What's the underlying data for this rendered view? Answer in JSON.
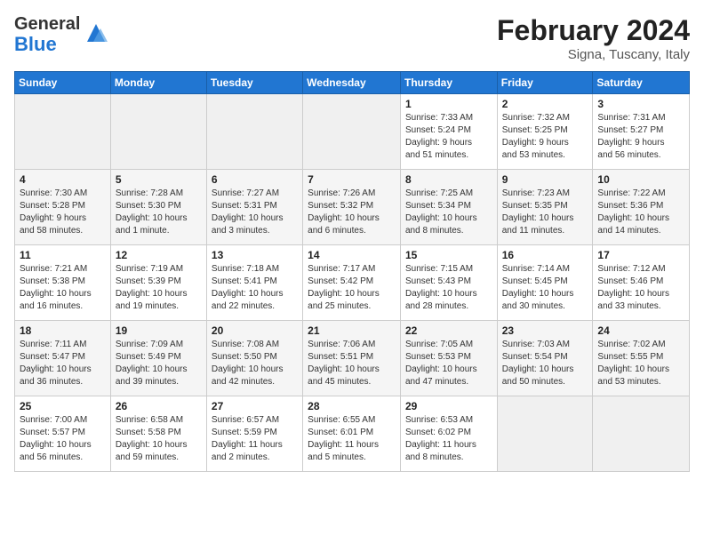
{
  "logo": {
    "line1": "General",
    "line2": "Blue"
  },
  "header": {
    "title": "February 2024",
    "subtitle": "Signa, Tuscany, Italy"
  },
  "weekdays": [
    "Sunday",
    "Monday",
    "Tuesday",
    "Wednesday",
    "Thursday",
    "Friday",
    "Saturday"
  ],
  "weeks": [
    [
      {
        "day": "",
        "info": ""
      },
      {
        "day": "",
        "info": ""
      },
      {
        "day": "",
        "info": ""
      },
      {
        "day": "",
        "info": ""
      },
      {
        "day": "1",
        "info": "Sunrise: 7:33 AM\nSunset: 5:24 PM\nDaylight: 9 hours\nand 51 minutes."
      },
      {
        "day": "2",
        "info": "Sunrise: 7:32 AM\nSunset: 5:25 PM\nDaylight: 9 hours\nand 53 minutes."
      },
      {
        "day": "3",
        "info": "Sunrise: 7:31 AM\nSunset: 5:27 PM\nDaylight: 9 hours\nand 56 minutes."
      }
    ],
    [
      {
        "day": "4",
        "info": "Sunrise: 7:30 AM\nSunset: 5:28 PM\nDaylight: 9 hours\nand 58 minutes."
      },
      {
        "day": "5",
        "info": "Sunrise: 7:28 AM\nSunset: 5:30 PM\nDaylight: 10 hours\nand 1 minute."
      },
      {
        "day": "6",
        "info": "Sunrise: 7:27 AM\nSunset: 5:31 PM\nDaylight: 10 hours\nand 3 minutes."
      },
      {
        "day": "7",
        "info": "Sunrise: 7:26 AM\nSunset: 5:32 PM\nDaylight: 10 hours\nand 6 minutes."
      },
      {
        "day": "8",
        "info": "Sunrise: 7:25 AM\nSunset: 5:34 PM\nDaylight: 10 hours\nand 8 minutes."
      },
      {
        "day": "9",
        "info": "Sunrise: 7:23 AM\nSunset: 5:35 PM\nDaylight: 10 hours\nand 11 minutes."
      },
      {
        "day": "10",
        "info": "Sunrise: 7:22 AM\nSunset: 5:36 PM\nDaylight: 10 hours\nand 14 minutes."
      }
    ],
    [
      {
        "day": "11",
        "info": "Sunrise: 7:21 AM\nSunset: 5:38 PM\nDaylight: 10 hours\nand 16 minutes."
      },
      {
        "day": "12",
        "info": "Sunrise: 7:19 AM\nSunset: 5:39 PM\nDaylight: 10 hours\nand 19 minutes."
      },
      {
        "day": "13",
        "info": "Sunrise: 7:18 AM\nSunset: 5:41 PM\nDaylight: 10 hours\nand 22 minutes."
      },
      {
        "day": "14",
        "info": "Sunrise: 7:17 AM\nSunset: 5:42 PM\nDaylight: 10 hours\nand 25 minutes."
      },
      {
        "day": "15",
        "info": "Sunrise: 7:15 AM\nSunset: 5:43 PM\nDaylight: 10 hours\nand 28 minutes."
      },
      {
        "day": "16",
        "info": "Sunrise: 7:14 AM\nSunset: 5:45 PM\nDaylight: 10 hours\nand 30 minutes."
      },
      {
        "day": "17",
        "info": "Sunrise: 7:12 AM\nSunset: 5:46 PM\nDaylight: 10 hours\nand 33 minutes."
      }
    ],
    [
      {
        "day": "18",
        "info": "Sunrise: 7:11 AM\nSunset: 5:47 PM\nDaylight: 10 hours\nand 36 minutes."
      },
      {
        "day": "19",
        "info": "Sunrise: 7:09 AM\nSunset: 5:49 PM\nDaylight: 10 hours\nand 39 minutes."
      },
      {
        "day": "20",
        "info": "Sunrise: 7:08 AM\nSunset: 5:50 PM\nDaylight: 10 hours\nand 42 minutes."
      },
      {
        "day": "21",
        "info": "Sunrise: 7:06 AM\nSunset: 5:51 PM\nDaylight: 10 hours\nand 45 minutes."
      },
      {
        "day": "22",
        "info": "Sunrise: 7:05 AM\nSunset: 5:53 PM\nDaylight: 10 hours\nand 47 minutes."
      },
      {
        "day": "23",
        "info": "Sunrise: 7:03 AM\nSunset: 5:54 PM\nDaylight: 10 hours\nand 50 minutes."
      },
      {
        "day": "24",
        "info": "Sunrise: 7:02 AM\nSunset: 5:55 PM\nDaylight: 10 hours\nand 53 minutes."
      }
    ],
    [
      {
        "day": "25",
        "info": "Sunrise: 7:00 AM\nSunset: 5:57 PM\nDaylight: 10 hours\nand 56 minutes."
      },
      {
        "day": "26",
        "info": "Sunrise: 6:58 AM\nSunset: 5:58 PM\nDaylight: 10 hours\nand 59 minutes."
      },
      {
        "day": "27",
        "info": "Sunrise: 6:57 AM\nSunset: 5:59 PM\nDaylight: 11 hours\nand 2 minutes."
      },
      {
        "day": "28",
        "info": "Sunrise: 6:55 AM\nSunset: 6:01 PM\nDaylight: 11 hours\nand 5 minutes."
      },
      {
        "day": "29",
        "info": "Sunrise: 6:53 AM\nSunset: 6:02 PM\nDaylight: 11 hours\nand 8 minutes."
      },
      {
        "day": "",
        "info": ""
      },
      {
        "day": "",
        "info": ""
      }
    ]
  ]
}
